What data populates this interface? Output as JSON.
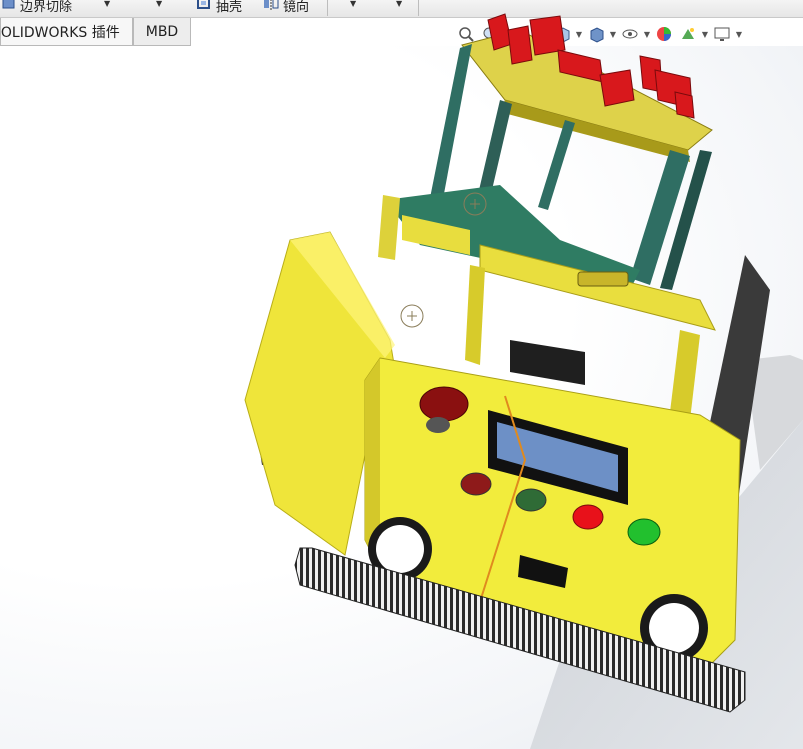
{
  "ribbon": {
    "boundary_cut_label": "边界切除",
    "shell_label": "抽壳",
    "mirror_label": "镜向"
  },
  "tabs": [
    {
      "label": "SOLIDWORKS 插件",
      "active": true
    },
    {
      "label": "MBD",
      "active": false
    }
  ],
  "heads_up_toolbar": {
    "icons": [
      "zoom-to-fit-icon",
      "zoom-area-icon",
      "previous-view-icon",
      "section-view-icon",
      "view-orientation-icon",
      "display-style-icon",
      "hide-show-icon",
      "edit-appearance-icon",
      "apply-scene-icon",
      "view-settings-icon"
    ]
  },
  "colors": {
    "body_yellow": "#f2ec3c",
    "frame_teal": "#2f6e63",
    "part_red": "#d8181c",
    "track_dark": "#2a2a2a",
    "screen_blue": "#6d90c6"
  }
}
